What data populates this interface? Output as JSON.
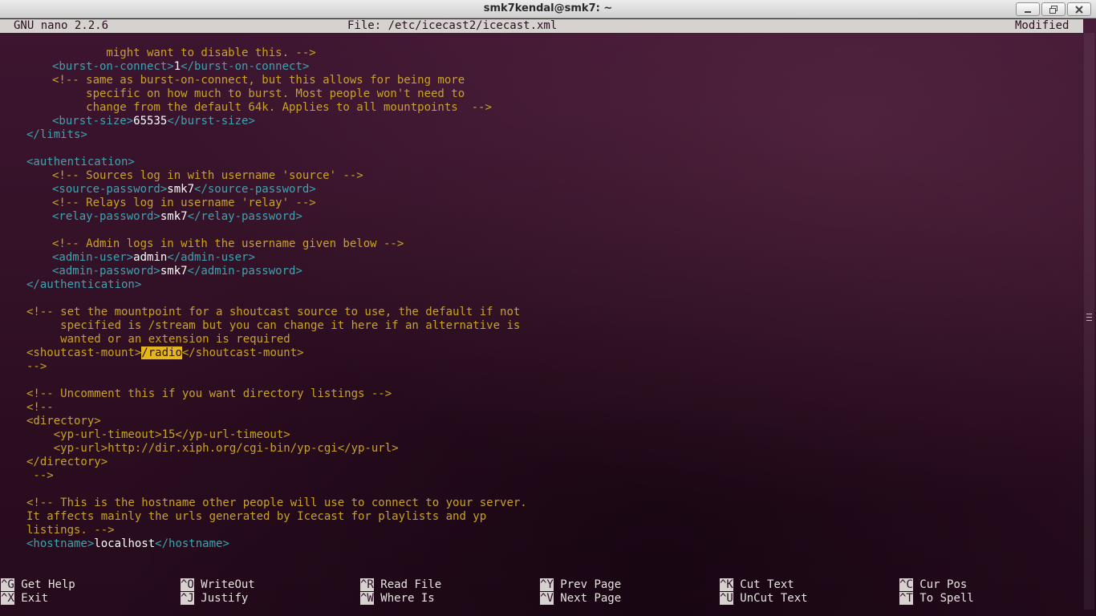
{
  "window": {
    "title": "smk7kendal@smk7: ~"
  },
  "nano": {
    "version": "GNU nano 2.2.6",
    "file": "File: /etc/icecast2/icecast.xml",
    "status": "Modified"
  },
  "editor": {
    "l1": "        might want to disable this. -->",
    "l2_open": "<burst-on-connect>",
    "l2_val": "1",
    "l2_close": "</burst-on-connect>",
    "l3": "<!-- same as burst-on-connect, but this allows for being more",
    "l4": "     specific on how much to burst. Most people won't need to",
    "l5": "     change from the default 64k. Applies to all mountpoints  -->",
    "l6_open": "<burst-size>",
    "l6_val": "65535",
    "l6_close": "</burst-size>",
    "l7": "</limits>",
    "l9": "<authentication>",
    "l10": "<!-- Sources log in with username 'source' -->",
    "l11_open": "<source-password>",
    "l11_val": "smk7",
    "l11_close": "</source-password>",
    "l12": "<!-- Relays log in username 'relay' -->",
    "l13_open": "<relay-password>",
    "l13_val": "smk7",
    "l13_close": "</relay-password>",
    "l15": "<!-- Admin logs in with the username given below -->",
    "l16_open": "<admin-user>",
    "l16_val": "admin",
    "l16_close": "</admin-user>",
    "l17_open": "<admin-password>",
    "l17_val": "smk7",
    "l17_close": "</admin-password>",
    "l18": "</authentication>",
    "l20": "<!-- set the mountpoint for a shoutcast source to use, the default if not",
    "l21": "     specified is /stream but you can change it here if an alternative is",
    "l22": "     wanted or an extension is required",
    "l23_open": "<shoutcast-mount>",
    "l23_val": "/radio",
    "l23_close": "</shoutcast-mount>",
    "l24": "-->",
    "l26": "<!-- Uncomment this if you want directory listings -->",
    "l27": "<!--",
    "l28": "<directory>",
    "l29": "    <yp-url-timeout>15</yp-url-timeout>",
    "l30": "    <yp-url>http://dir.xiph.org/cgi-bin/yp-cgi</yp-url>",
    "l31": "</directory>",
    "l32": " -->",
    "l34": "<!-- This is the hostname other people will use to connect to your server.",
    "l35": "It affects mainly the urls generated by Icecast for playlists and yp",
    "l36": "listings. -->",
    "l37_open": "<hostname>",
    "l37_val": "localhost",
    "l37_close": "</hostname>"
  },
  "shortcuts": [
    {
      "key": "^G",
      "label": "Get Help"
    },
    {
      "key": "^O",
      "label": "WriteOut"
    },
    {
      "key": "^R",
      "label": "Read File"
    },
    {
      "key": "^Y",
      "label": "Prev Page"
    },
    {
      "key": "^K",
      "label": "Cut Text"
    },
    {
      "key": "^C",
      "label": "Cur Pos"
    },
    {
      "key": "^X",
      "label": "Exit"
    },
    {
      "key": "^J",
      "label": "Justify"
    },
    {
      "key": "^W",
      "label": "Where Is"
    },
    {
      "key": "^V",
      "label": "Next Page"
    },
    {
      "key": "^U",
      "label": "UnCut Text"
    },
    {
      "key": "^T",
      "label": "To Spell"
    }
  ],
  "colors": {
    "comment": "#c9a227",
    "tag": "#3fa3b0",
    "value": "#ffffff",
    "search_highlight": "#e4b81c",
    "background": "#2c0f22"
  }
}
